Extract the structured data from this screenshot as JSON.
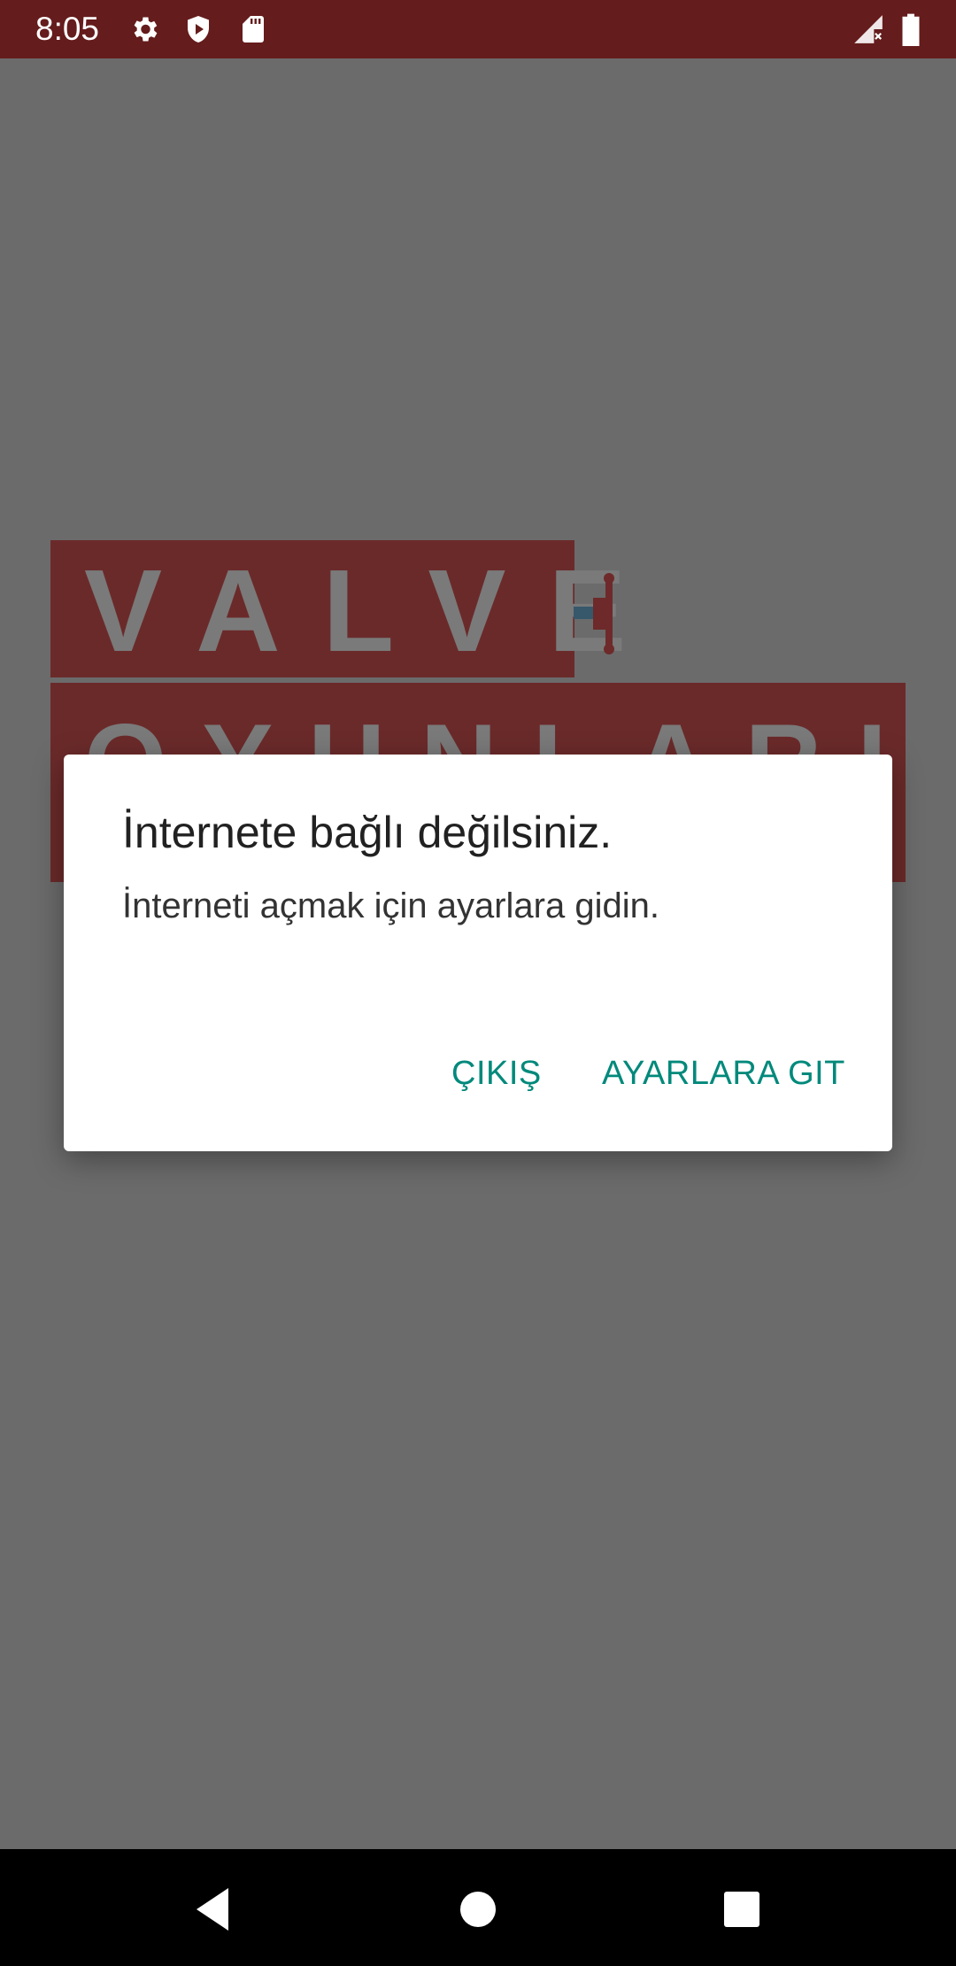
{
  "status_bar": {
    "time": "8:05",
    "icons": [
      "gear-icon",
      "shield-play-icon",
      "sd-card-icon",
      "signal-off-icon",
      "battery-icon"
    ]
  },
  "background": {
    "logo_line1": "VALVE",
    "logo_line2": "OYUNLARI"
  },
  "dialog": {
    "title": "İnternete bağlı değilsiniz.",
    "message": "İnterneti açmak için ayarlara gidin.",
    "exit_label": "ÇIKIŞ",
    "settings_label": "AYARLARA GIT"
  },
  "nav_bar": {
    "icons": [
      "back-icon",
      "home-icon",
      "recents-icon"
    ]
  },
  "colors": {
    "status_bar": "#651c1c",
    "accent": "#00897b",
    "scrim": "#6b6b6b"
  }
}
